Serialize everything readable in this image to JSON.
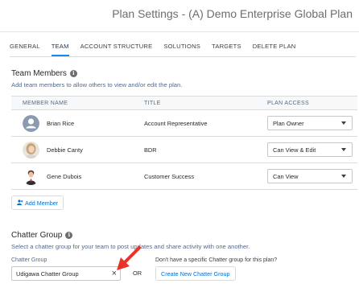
{
  "page": {
    "title": "Plan Settings - (A) Demo Enterprise Global Plan"
  },
  "tabs": [
    {
      "label": "GENERAL"
    },
    {
      "label": "TEAM"
    },
    {
      "label": "ACCOUNT STRUCTURE"
    },
    {
      "label": "SOLUTIONS"
    },
    {
      "label": "TARGETS"
    },
    {
      "label": "DELETE PLAN"
    }
  ],
  "active_tab": "TEAM",
  "team": {
    "title": "Team Members",
    "description": "Add team members to allow others to view and/or edit the plan.",
    "columns": [
      "MEMBER NAME",
      "TITLE",
      "PLAN ACCESS"
    ],
    "rows": [
      {
        "name": "Brian Rice",
        "title": "Account Representative",
        "access": "Plan Owner",
        "avatar": "default-user-icon"
      },
      {
        "name": "Debbie Canty",
        "title": "BDR",
        "access": "Can View & Edit",
        "avatar": "photo-woman"
      },
      {
        "name": "Gene Dubois",
        "title": "Customer Success",
        "access": "Can View",
        "avatar": "photo-man"
      }
    ],
    "add_member_label": "Add Member"
  },
  "chatter": {
    "title": "Chatter Group",
    "description": "Select a chatter group for your team to post updates and share activity with one another.",
    "field_label": "Chatter Group",
    "value": "Udigawa Chatter Group",
    "or_label": "OR",
    "alt_question": "Don't have a specific Chatter group for this plan?",
    "create_label": "Create New Chatter Group"
  },
  "colors": {
    "accent": "#1589ee",
    "link": "#0070d2",
    "arrow": "#e8332a"
  }
}
